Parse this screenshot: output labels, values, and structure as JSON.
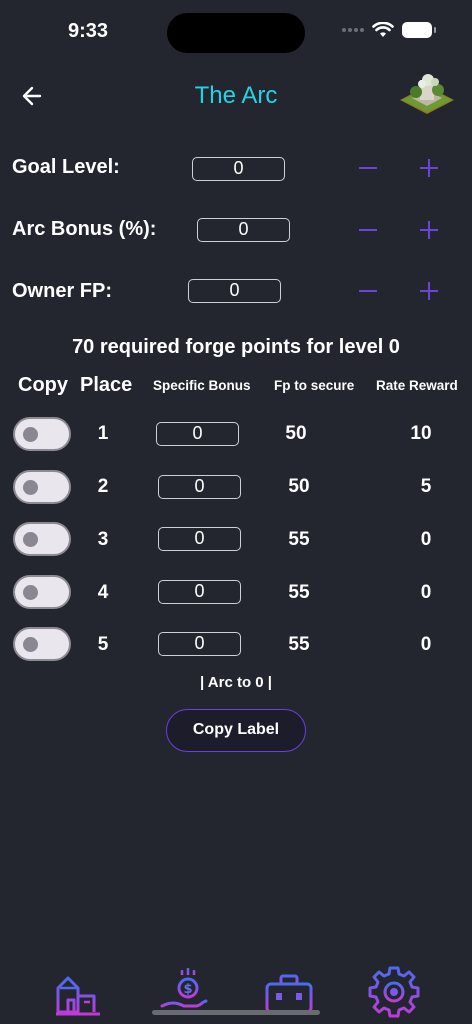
{
  "status_bar": {
    "time": "9:33"
  },
  "header": {
    "title": "The Arc",
    "back_icon": "arrow-left-icon",
    "thumbnail_icon": "building-thumbnail-icon"
  },
  "settings": {
    "goal_level": {
      "label": "Goal Level:",
      "value": "0"
    },
    "arc_bonus": {
      "label": "Arc Bonus (%):",
      "value": "0"
    },
    "owner_fp": {
      "label": "Owner FP:",
      "value": "0"
    },
    "minus_glyph": "−",
    "plus_glyph": "+"
  },
  "summary": "70 required forge points for level 0",
  "table": {
    "headers": {
      "copy": "Copy",
      "place": "Place",
      "specific_bonus": "Specific Bonus",
      "fp_to_secure": "Fp to secure",
      "rate_reward": "Rate Reward"
    },
    "rows": [
      {
        "place": "1",
        "bonus": "0",
        "fp": "50",
        "reward": "10",
        "copy": false
      },
      {
        "place": "2",
        "bonus": "0",
        "fp": "50",
        "reward": "5",
        "copy": false
      },
      {
        "place": "3",
        "bonus": "0",
        "fp": "55",
        "reward": "0",
        "copy": false
      },
      {
        "place": "4",
        "bonus": "0",
        "fp": "55",
        "reward": "0",
        "copy": false
      },
      {
        "place": "5",
        "bonus": "0",
        "fp": "55",
        "reward": "0",
        "copy": false
      }
    ]
  },
  "arc_label": "| Arc to 0 |",
  "copy_button": "Copy Label",
  "tab_bar": [
    "city-icon",
    "money-hand-icon",
    "toolbox-icon",
    "settings-gear-icon"
  ],
  "colors": {
    "background": "#24262f",
    "title": "#22d3e6",
    "accent": "#6b3fe0"
  }
}
